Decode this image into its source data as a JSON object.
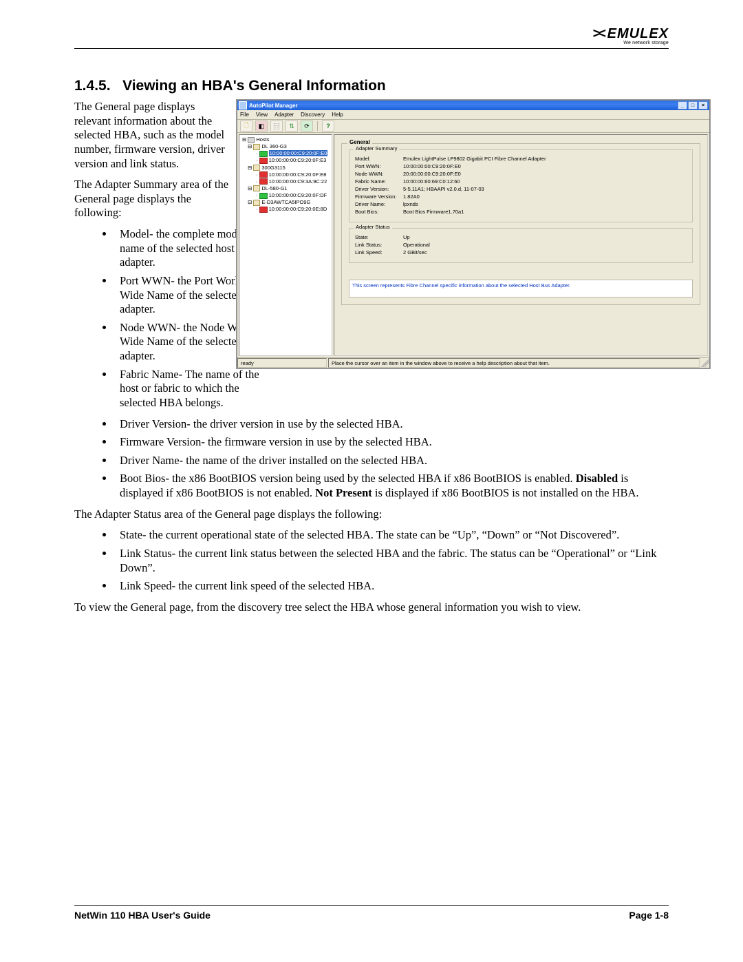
{
  "brand": {
    "name": "EMULEX",
    "tagline": "We network storage"
  },
  "section": {
    "number": "1.4.5.",
    "title": "Viewing an HBA's General Information"
  },
  "paras": {
    "p1": "The General page displays relevant information about the selected HBA, such as the model number, firmware version, driver version and link status.",
    "p2": "The Adapter Summary area of the General page displays the following:",
    "p3": "The Adapter Status area of the General page displays the following:",
    "p4": "To view the General page, from the discovery tree select the HBA whose general information you wish to view."
  },
  "list_summary": [
    "Model- the complete model name of the selected host bus adapter.",
    "Port WWN- the Port World Wide Name of the selected adapter.",
    "Node WWN- the Node World Wide Name of the selected adapter.",
    "Fabric Name- The name of the host or fabric to which the selected HBA belongs.",
    "Driver Version- the driver version in use by the selected HBA.",
    "Firmware Version- the firmware version in use by the selected HBA.",
    "Driver Name- the name of the driver installed on the selected HBA."
  ],
  "boot_bios_item": {
    "prefix": "Boot Bios- the x86 BootBIOS version being used by the selected HBA if x86 BootBIOS is enabled. ",
    "bold1": "Disabled",
    "mid1": " is displayed if x86 BootBIOS is not enabled. ",
    "bold2": "Not Present",
    "mid2": " is displayed if x86 BootBIOS is not installed on the HBA."
  },
  "list_status": [
    "State- the current operational state of the selected HBA. The state can be “Up”, “Down” or “Not Discovered”.",
    "Link Status- the current link status between the selected HBA and the fabric. The status can be “Operational” or “Link Down”.",
    "Link Speed- the current link speed of the selected HBA."
  ],
  "app": {
    "title": "AutoPilot Manager",
    "menus": [
      "File",
      "View",
      "Adapter",
      "Discovery",
      "Help"
    ],
    "status_ready": "ready",
    "status_hint": "Place the cursor over an item in the window above to receive a help description about that item.",
    "help_text": "This screen represents Fibre Channel specific information about the selected Host Bus Adapter.",
    "tree": {
      "root": "Hosts",
      "hosts": [
        {
          "name": "DL 360-G3",
          "children": [
            {
              "name": "10:00:00:00:C9:20:0F:E0",
              "color": "g",
              "selected": true
            },
            {
              "name": "10:00:00:00:C9:20:0F:E3",
              "color": "r"
            }
          ]
        },
        {
          "name": "300G3115",
          "children": [
            {
              "name": "10:00:00:00:C9:20:0F:E8",
              "color": "r"
            },
            {
              "name": "10:00:00:00:C9:3A:9C:22",
              "color": "r"
            }
          ]
        },
        {
          "name": "DL-580-G1",
          "children": [
            {
              "name": "10:00:00:00:C9:20:0F:DF",
              "color": "g"
            }
          ]
        },
        {
          "name": "E-D3AWTCA5IPO9G",
          "children": [
            {
              "name": "10:00:00:00:C9:20:0E:8D",
              "color": "r"
            }
          ]
        }
      ]
    },
    "general": {
      "title": "General",
      "summary": {
        "title": "Adapter Summary",
        "rows": [
          {
            "label": "Model:",
            "value": "Emulex LightPulse LP9802 Gigabit PCI Fibre Channel Adapter"
          },
          {
            "label": "Port WWN:",
            "value": "10:00:00:00:C9:20:0F:E0"
          },
          {
            "label": "Node WWN:",
            "value": "20:00:00:00:C9:20:0F:E0"
          },
          {
            "label": "Fabric Name:",
            "value": "10:00:00:60:69:C0:12:60"
          },
          {
            "label": "Driver Version:",
            "value": "5-5.11A1; HBAAPI v2.0.d, 11-07-03"
          },
          {
            "label": "Firmware Version:",
            "value": "1.82A0"
          },
          {
            "label": "Driver Name:",
            "value": "lpxnds"
          },
          {
            "label": "Boot Bios:",
            "value": "Boot Bios Firmware1.70a1"
          }
        ]
      },
      "status": {
        "title": "Adapter Status",
        "rows": [
          {
            "label": "State:",
            "value": "Up"
          },
          {
            "label": "Link Status:",
            "value": "Operational"
          },
          {
            "label": "Link Speed:",
            "value": "2 GBit/sec"
          }
        ]
      }
    }
  },
  "footer": {
    "left": "NetWin 110 HBA User's Guide",
    "right": "Page  1-8"
  }
}
